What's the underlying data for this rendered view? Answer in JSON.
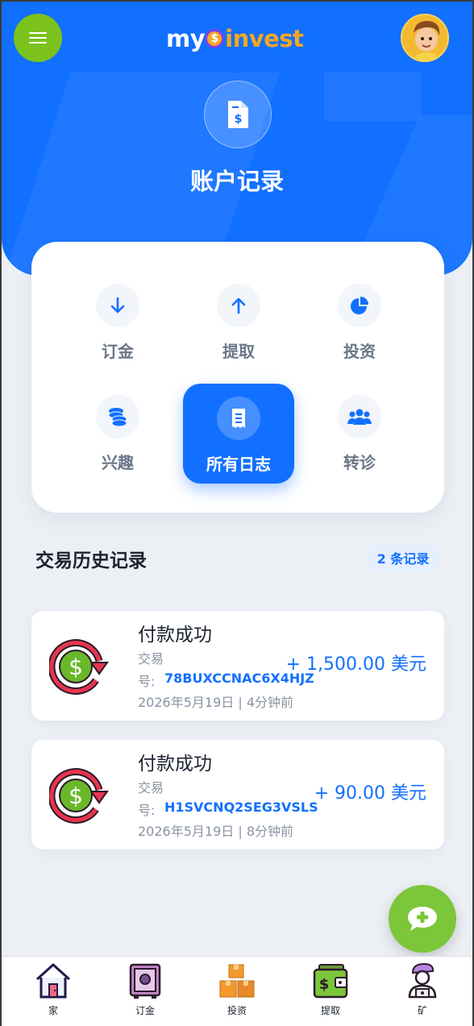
{
  "header": {
    "logo_part1": "my",
    "logo_coin": "$",
    "logo_part2": "invest",
    "title": "账户记录"
  },
  "categories": [
    {
      "label": "订金",
      "icon": "arrow-down-icon"
    },
    {
      "label": "提取",
      "icon": "arrow-up-icon"
    },
    {
      "label": "投资",
      "icon": "pie-chart-icon"
    },
    {
      "label": "兴趣",
      "icon": "coins-icon"
    },
    {
      "label": "所有日志",
      "icon": "receipt-icon",
      "active": true
    },
    {
      "label": "转诊",
      "icon": "users-icon"
    }
  ],
  "history": {
    "title": "交易历史记录",
    "count_label": "2 条记录",
    "transactions": [
      {
        "title": "付款成功",
        "label_line1": "交易",
        "label_line2": "号:",
        "txid": "78BUXCCNAC6X4HJZ",
        "date": "2026年5月19日 | 4分钟前",
        "amount": "+ 1,500.00 美元"
      },
      {
        "title": "付款成功",
        "label_line1": "交易",
        "label_line2": "号:",
        "txid": "H1SVCNQ2SEG3VSLS",
        "date": "2026年5月19日 | 8分钟前",
        "amount": "+ 90.00 美元"
      }
    ]
  },
  "bottom_nav": [
    {
      "label": "家",
      "icon": "home-icon"
    },
    {
      "label": "订金",
      "icon": "safe-icon"
    },
    {
      "label": "投资",
      "icon": "boxes-icon"
    },
    {
      "label": "提取",
      "icon": "wallet-icon"
    },
    {
      "label": "矿",
      "icon": "miner-icon"
    }
  ],
  "colors": {
    "primary": "#1170ff",
    "accent_green": "#7cc21c",
    "background": "#ecf0f5"
  }
}
